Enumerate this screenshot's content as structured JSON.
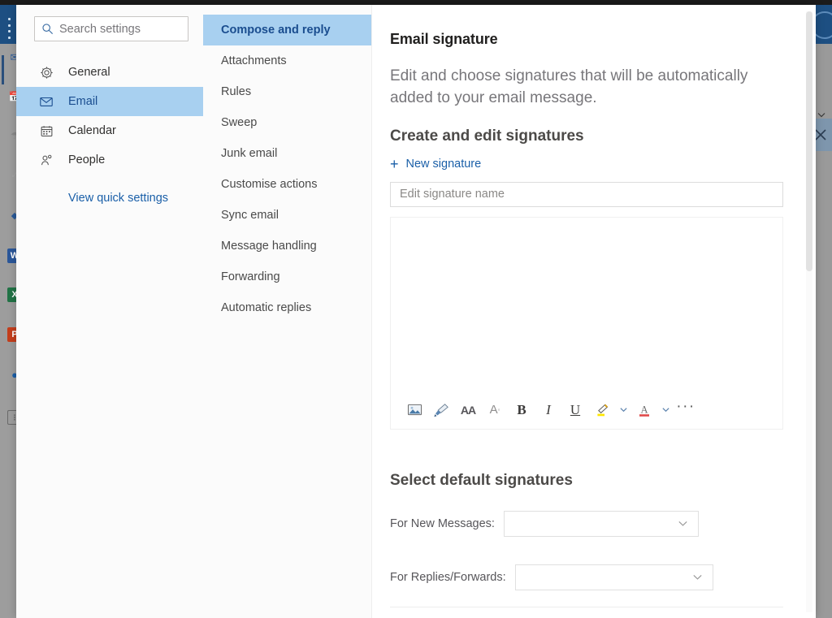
{
  "app": {
    "brand_color": "#1d4f82",
    "accent_color": "#1a5fa8",
    "selected_bg": "#a8d0f0",
    "rail_bg": "#9d9d9d"
  },
  "background": {
    "waffle_icon": "app-launcher-icon",
    "close_icon": "close-icon",
    "chevron_icon": "chevron-down-icon",
    "rail_apps": [
      {
        "name": "outlook-app-icon",
        "glyph": "O",
        "color": "#2a5a99"
      },
      {
        "name": "calendar-app-icon",
        "glyph": "E",
        "color": "#8a8a8a"
      },
      {
        "name": "people-app-icon",
        "glyph": "S",
        "color": "#8a8a8a"
      },
      {
        "name": "tasks-app-icon",
        "glyph": "x",
        "color": "#8a8a8a"
      },
      {
        "name": "onedrive-app-icon",
        "glyph": "◆",
        "color": "#2a5a99"
      },
      {
        "name": "word-app-icon",
        "glyph": "W",
        "color": "#2b579a"
      },
      {
        "name": "excel-app-icon",
        "glyph": "X",
        "color": "#217346"
      },
      {
        "name": "powerpoint-app-icon",
        "glyph": "P",
        "color": "#c43e1c"
      },
      {
        "name": "onenote-app-icon",
        "glyph": "●",
        "color": "#1a5fa8"
      },
      {
        "name": "more-apps-icon",
        "glyph": "⋮",
        "color": "#6a6a6a"
      }
    ]
  },
  "search": {
    "placeholder": "Search settings",
    "value": "",
    "icon": "search-icon"
  },
  "sidebar": {
    "items": [
      {
        "label": "General",
        "icon": "gear-icon",
        "selected": false
      },
      {
        "label": "Email",
        "icon": "envelope-icon",
        "selected": true
      },
      {
        "label": "Calendar",
        "icon": "calendar-icon",
        "selected": false
      },
      {
        "label": "People",
        "icon": "people-icon",
        "selected": false
      }
    ],
    "quick_settings_link": "View quick settings"
  },
  "subnav": {
    "items": [
      {
        "label": "Compose and reply",
        "selected": true
      },
      {
        "label": "Attachments",
        "selected": false
      },
      {
        "label": "Rules",
        "selected": false
      },
      {
        "label": "Sweep",
        "selected": false
      },
      {
        "label": "Junk email",
        "selected": false
      },
      {
        "label": "Customise actions",
        "selected": false
      },
      {
        "label": "Sync email",
        "selected": false
      },
      {
        "label": "Message handling",
        "selected": false
      },
      {
        "label": "Forwarding",
        "selected": false
      },
      {
        "label": "Automatic replies",
        "selected": false
      }
    ]
  },
  "main": {
    "title": "Email signature",
    "description": "Edit and choose signatures that will be automatically added to your email message.",
    "create_heading": "Create and edit signatures",
    "new_signature_label": "New signature",
    "new_signature_plus": "+",
    "signature_name": {
      "placeholder": "Edit signature name",
      "value": ""
    },
    "editor": {
      "content": "",
      "toolbar": [
        {
          "name": "insert-picture-icon",
          "label": ""
        },
        {
          "name": "format-painter-icon",
          "label": ""
        },
        {
          "name": "font-size-icon",
          "label": "AA"
        },
        {
          "name": "text-effects-icon",
          "label": "A"
        },
        {
          "name": "bold-icon",
          "label": "B"
        },
        {
          "name": "italic-icon",
          "label": "I"
        },
        {
          "name": "underline-icon",
          "label": "U"
        },
        {
          "name": "highlight-color-icon",
          "label": ""
        },
        {
          "name": "font-color-icon",
          "label": "A"
        },
        {
          "name": "more-formatting-icon",
          "label": "···"
        }
      ],
      "highlight_color": "#ffe600",
      "font_color": "#e04a4a"
    },
    "defaults_heading": "Select default signatures",
    "defaults": [
      {
        "label": "For New Messages:",
        "value": "",
        "name": "new-messages-signature-select"
      },
      {
        "label": "For Replies/Forwards:",
        "value": "",
        "name": "replies-forwards-signature-select"
      }
    ]
  }
}
